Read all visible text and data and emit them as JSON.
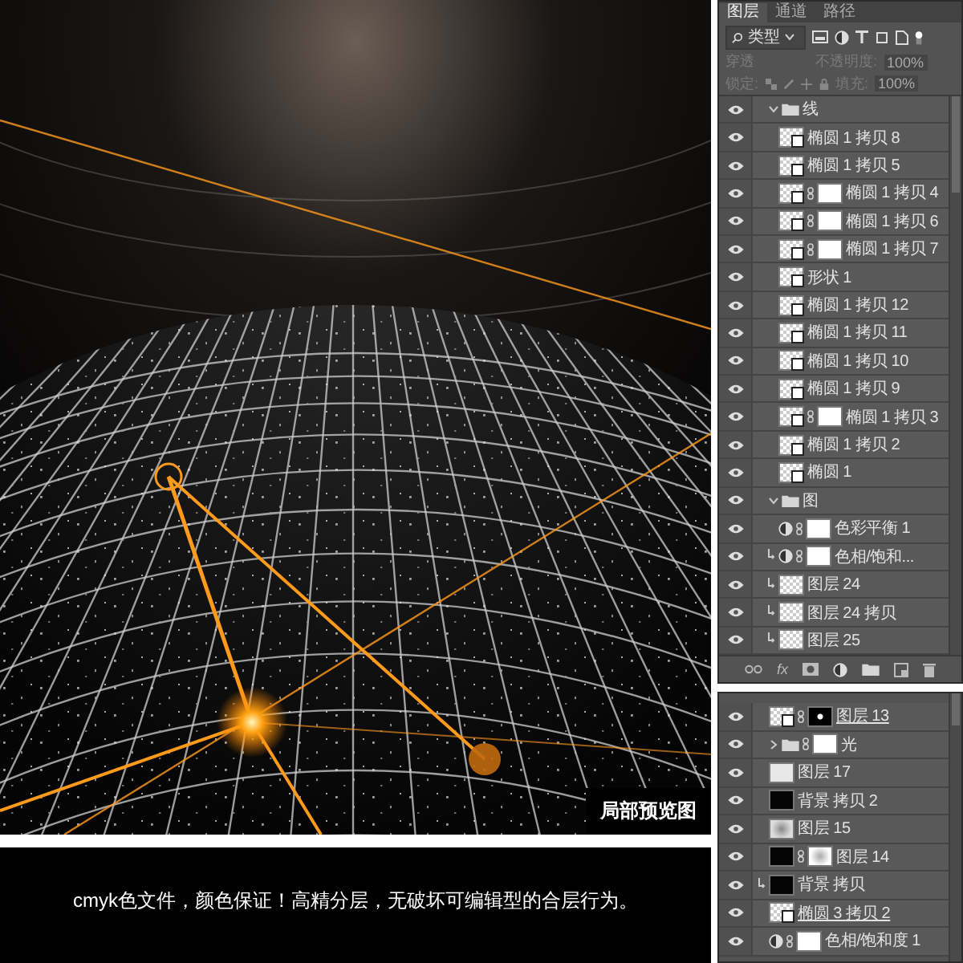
{
  "preview": {
    "label": "局部预览图"
  },
  "caption": "cmyk色文件，颜色保证！高精分层，无破坏可编辑型的合层行为。",
  "layers_panel": {
    "tabs": [
      {
        "label": "图层",
        "selected": true
      },
      {
        "label": "通道",
        "selected": false
      },
      {
        "label": "路径",
        "selected": false
      }
    ],
    "filter": "类型",
    "blend_mode": "穿透",
    "opacity_label": "不透明度:",
    "opacity": "100%",
    "lock_label": "锁定:",
    "fill_label": "填充:",
    "fill": "100%",
    "effects_label": "fx",
    "layers": [
      {
        "kind": "group",
        "name": "线",
        "visible": true,
        "clipped": false,
        "expanded": true,
        "children": [
          {
            "kind": "shape",
            "name": "椭圆 1 拷贝 8",
            "visible": true,
            "clipped": false
          },
          {
            "kind": "shape",
            "name": "椭圆 1 拷贝 5",
            "visible": true,
            "clipped": false
          },
          {
            "kind": "shape",
            "name": "椭圆 1 拷贝 4",
            "visible": true,
            "clipped": false,
            "mask": {
              "kind": "white"
            }
          },
          {
            "kind": "shape",
            "name": "椭圆 1 拷贝 6",
            "visible": true,
            "clipped": false,
            "mask": {
              "kind": "white"
            }
          },
          {
            "kind": "shape",
            "name": "椭圆 1 拷贝 7",
            "visible": true,
            "clipped": false,
            "mask": {
              "kind": "white"
            }
          },
          {
            "kind": "shape",
            "name": "形状 1",
            "visible": true,
            "clipped": false
          },
          {
            "kind": "shape",
            "name": "椭圆 1 拷贝 12",
            "visible": true,
            "clipped": false
          },
          {
            "kind": "shape",
            "name": "椭圆 1 拷贝 11",
            "visible": true,
            "clipped": false
          },
          {
            "kind": "shape",
            "name": "椭圆 1 拷贝 10",
            "visible": true,
            "clipped": false
          },
          {
            "kind": "shape",
            "name": "椭圆 1 拷贝 9",
            "visible": true,
            "clipped": false
          },
          {
            "kind": "shape",
            "name": "椭圆 1 拷贝 3",
            "visible": true,
            "clipped": false,
            "mask": {
              "kind": "white"
            }
          },
          {
            "kind": "shape",
            "name": "椭圆 1 拷贝 2",
            "visible": true,
            "clipped": false
          },
          {
            "kind": "shape",
            "name": "椭圆 1",
            "visible": true,
            "clipped": false
          }
        ]
      },
      {
        "kind": "group",
        "name": "图",
        "visible": true,
        "clipped": false,
        "expanded": true,
        "children": [
          {
            "kind": "adjustment",
            "name": "色彩平衡 1",
            "visible": true,
            "clipped": false,
            "mask": {
              "kind": "white"
            }
          },
          {
            "kind": "adjustment",
            "name": "色相/饱和...",
            "visible": true,
            "clipped": true,
            "mask": {
              "kind": "white"
            }
          },
          {
            "kind": "pixel",
            "name": "图层 24",
            "visible": true,
            "clipped": true,
            "thumb": {
              "kind": "checker"
            }
          },
          {
            "kind": "pixel",
            "name": "图层 24 拷贝",
            "visible": true,
            "clipped": true,
            "thumb": {
              "kind": "checker"
            }
          },
          {
            "kind": "pixel",
            "name": "图层 25",
            "visible": true,
            "clipped": true,
            "thumb": {
              "kind": "checker"
            }
          }
        ]
      }
    ]
  },
  "layers_panel_2": {
    "layers": [
      {
        "kind": "smart",
        "name": "图层 13",
        "visible": true,
        "clipped": false,
        "underlined": true,
        "thumb": {
          "kind": "checker"
        },
        "mask": {
          "kind": "black"
        }
      },
      {
        "kind": "group",
        "name": "光",
        "visible": true,
        "clipped": false,
        "underlined": false,
        "expanded": false,
        "mask": {
          "kind": "white"
        }
      },
      {
        "kind": "pixel",
        "name": "图层 17",
        "visible": true,
        "clipped": false,
        "underlined": false,
        "thumb": {
          "kind": "light"
        }
      },
      {
        "kind": "pixel",
        "name": "背景 拷贝 2",
        "visible": true,
        "clipped": false,
        "underlined": false,
        "thumb": {
          "kind": "black"
        }
      },
      {
        "kind": "pixel",
        "name": "图层 15",
        "visible": true,
        "clipped": false,
        "underlined": false,
        "thumb": {
          "kind": "texture"
        }
      },
      {
        "kind": "pixel",
        "name": "图层 14",
        "visible": true,
        "clipped": false,
        "underlined": false,
        "thumb": {
          "kind": "black"
        },
        "mask": {
          "kind": "soft"
        }
      },
      {
        "kind": "pixel",
        "name": "背景 拷贝",
        "visible": true,
        "clipped": true,
        "underlined": false,
        "thumb": {
          "kind": "black"
        }
      },
      {
        "kind": "shape",
        "name": "椭圆 3 拷贝 2",
        "visible": true,
        "clipped": false,
        "underlined": true
      },
      {
        "kind": "adjustment",
        "name": "色相/饱和度 1",
        "visible": true,
        "clipped": false,
        "underlined": false,
        "mask": {
          "kind": "white"
        }
      }
    ]
  }
}
